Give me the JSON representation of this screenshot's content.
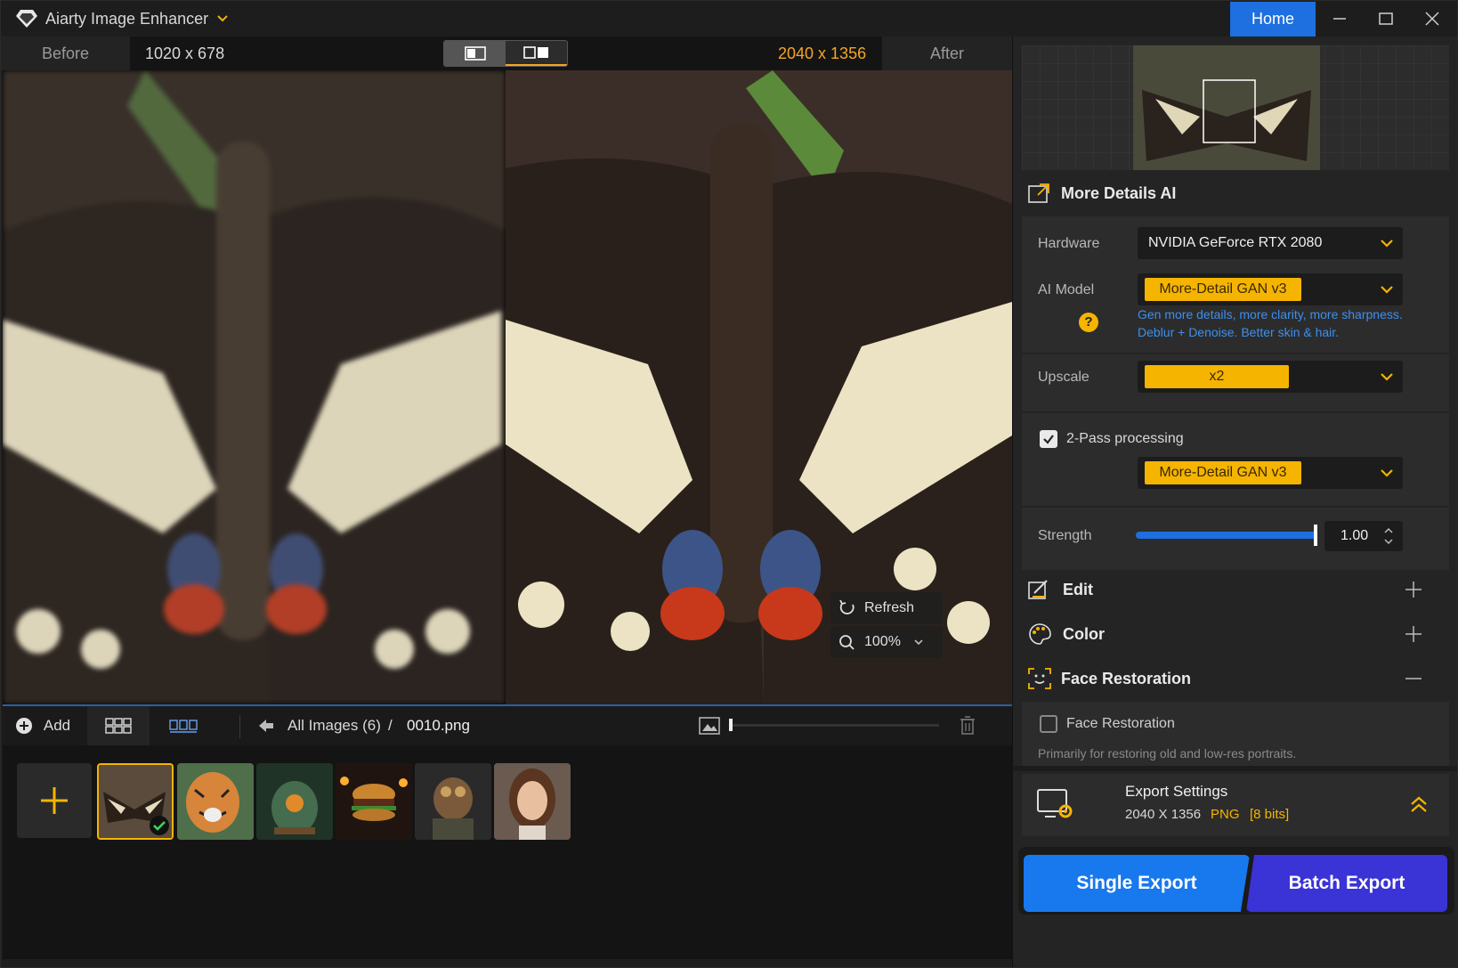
{
  "window": {
    "title": "Aiarty Image Enhancer",
    "home_label": "Home",
    "controls": [
      "minimize-icon",
      "maximize-icon",
      "close-icon"
    ]
  },
  "compare": {
    "before_label": "Before",
    "before_resolution": "1020 x 678",
    "after_resolution": "2040 x 1356",
    "after_label": "After"
  },
  "image_overlay": {
    "refresh_label": "Refresh",
    "zoom_value": "100%"
  },
  "bottom_bar": {
    "add_label": "Add",
    "breadcrumb_root": "All Images (6)",
    "breadcrumb_sep": "/",
    "breadcrumb_file": "0010.png"
  },
  "thumbnails": [
    {
      "subject": "butterfly",
      "selected": true,
      "processed": true
    },
    {
      "subject": "tiger"
    },
    {
      "subject": "terrarium"
    },
    {
      "subject": "burger"
    },
    {
      "subject": "dog"
    },
    {
      "subject": "portrait"
    }
  ],
  "panel": {
    "model_section_title": "More Details AI",
    "hardware_label": "Hardware",
    "hardware_value": "NVIDIA GeForce RTX 2080",
    "ai_model_label": "AI Model",
    "ai_model_value": "More-Detail GAN  v3",
    "ai_model_desc_line1": "Gen more details, more clarity, more sharpness.",
    "ai_model_desc_line2": "Deblur + Denoise. Better skin & hair.",
    "help_symbol": "?",
    "upscale_label": "Upscale",
    "upscale_value": "x2",
    "two_pass_label": "2-Pass processing",
    "two_pass_checked": true,
    "two_pass_model_value": "More-Detail GAN  v3",
    "strength_label": "Strength",
    "strength_value": "1.00",
    "strength_fraction": 1.0,
    "edit_title": "Edit",
    "color_title": "Color",
    "face_title": "Face Restoration",
    "face_checkbox_label": "Face Restoration",
    "face_desc": "Primarily for restoring old and low-res portraits.",
    "export_title": "Export Settings",
    "export_dims": "2040 X 1356",
    "export_format": "PNG",
    "export_bits": "[8 bits]",
    "single_export": "Single Export",
    "batch_export": "Batch Export"
  },
  "colors": {
    "accent_orange": "#f5b400",
    "accent_blue": "#1e6fe0",
    "batch_purple": "#3a33d6"
  }
}
